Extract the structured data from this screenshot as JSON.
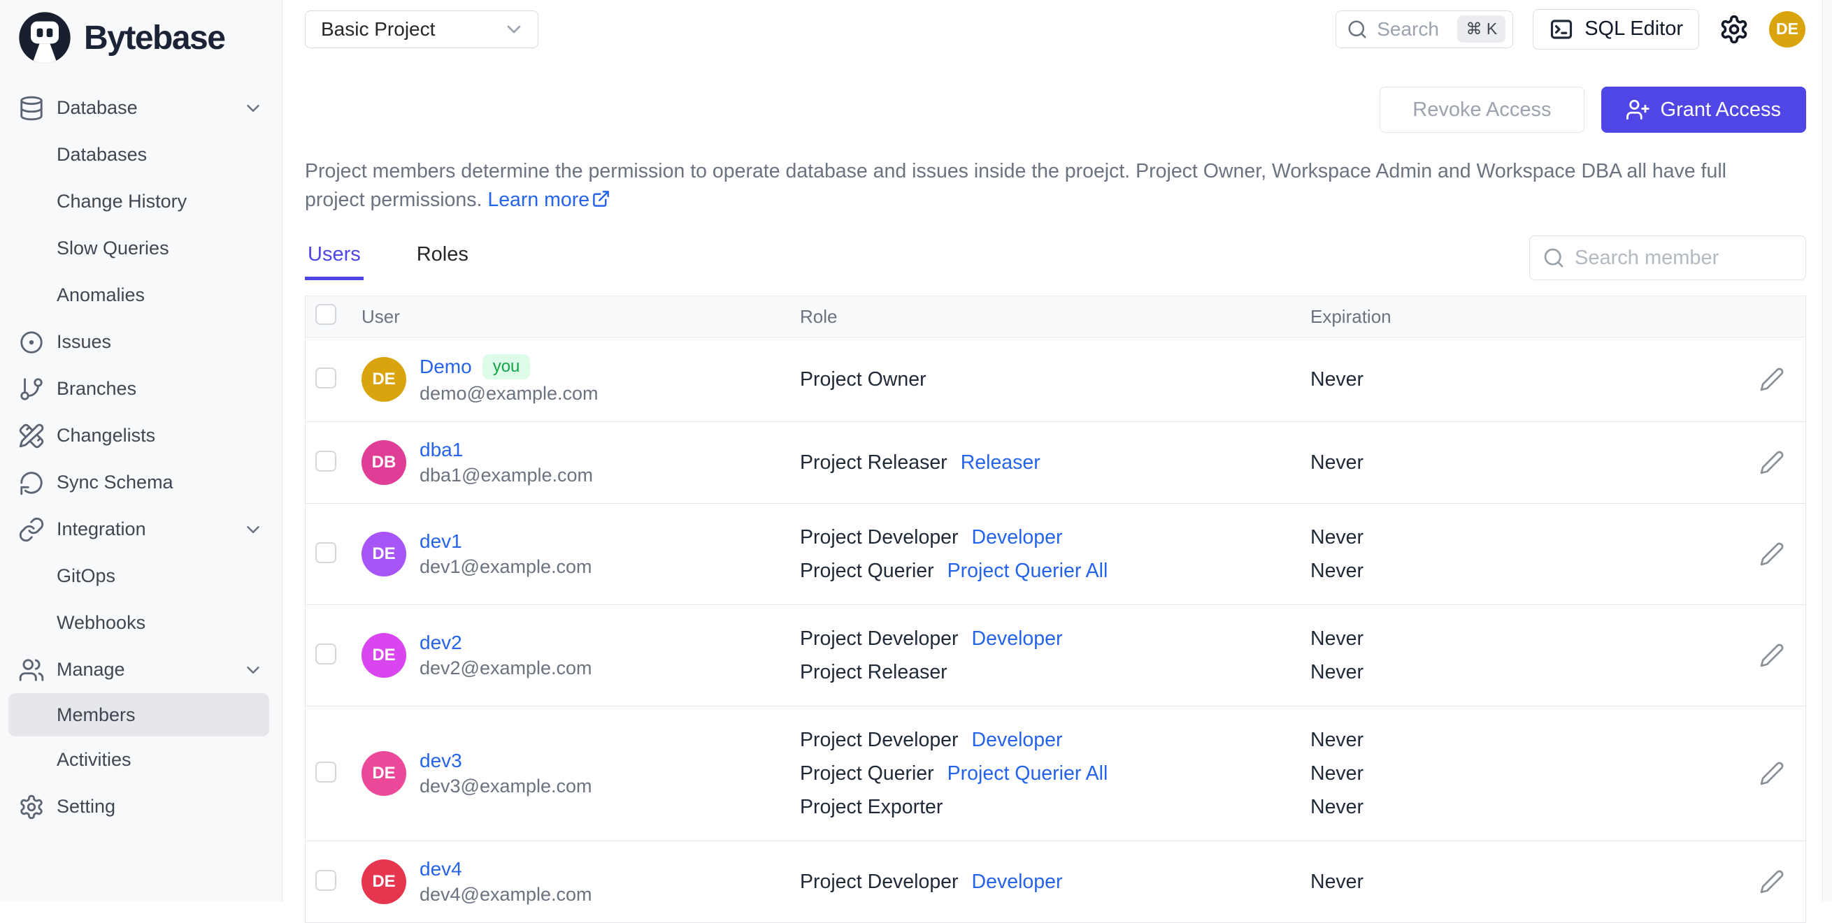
{
  "brand": {
    "name": "Bytebase"
  },
  "sidebar": {
    "items": [
      {
        "label": "Database",
        "icon": "database-icon",
        "type": "group",
        "chevron": true
      },
      {
        "label": "Databases",
        "type": "sub"
      },
      {
        "label": "Change History",
        "type": "sub"
      },
      {
        "label": "Slow Queries",
        "type": "sub"
      },
      {
        "label": "Anomalies",
        "type": "sub"
      },
      {
        "label": "Issues",
        "icon": "circle-dot-icon",
        "type": "top"
      },
      {
        "label": "Branches",
        "icon": "git-branch-icon",
        "type": "top"
      },
      {
        "label": "Changelists",
        "icon": "pencil-ruler-icon",
        "type": "top"
      },
      {
        "label": "Sync Schema",
        "icon": "sync-icon",
        "type": "top"
      },
      {
        "label": "Integration",
        "icon": "link-icon",
        "type": "group",
        "chevron": true
      },
      {
        "label": "GitOps",
        "type": "sub"
      },
      {
        "label": "Webhooks",
        "type": "sub"
      },
      {
        "label": "Manage",
        "icon": "users-icon",
        "type": "group",
        "chevron": true
      },
      {
        "label": "Members",
        "type": "sub",
        "active": true
      },
      {
        "label": "Activities",
        "type": "sub"
      },
      {
        "label": "Setting",
        "icon": "gear-icon",
        "type": "top"
      }
    ]
  },
  "topbar": {
    "project_select": "Basic Project",
    "search_placeholder": "Search",
    "search_shortcut": "⌘ K",
    "sql_editor_label": "SQL Editor",
    "avatar_initials": "DE",
    "avatar_color": "#d9a40e"
  },
  "actions": {
    "revoke_label": "Revoke Access",
    "grant_label": "Grant Access"
  },
  "description": {
    "text": "Project members determine the permission to operate database and issues inside the proejct. Project Owner, Workspace Admin and Workspace DBA all have full project permissions.",
    "learn_more": "Learn more"
  },
  "tabs": {
    "users": "Users",
    "roles": "Roles"
  },
  "member_search": {
    "placeholder": "Search member"
  },
  "colors": {
    "accent": "#4f46e5",
    "link": "#2563eb"
  },
  "table": {
    "columns": {
      "user": "User",
      "role": "Role",
      "expiration": "Expiration"
    },
    "rows": [
      {
        "name": "Demo",
        "badge": "you",
        "email": "demo@example.com",
        "initials": "DE",
        "avatar_color": "#d9a40e",
        "roles": [
          {
            "label": "Project Owner",
            "link": ""
          }
        ],
        "expirations": [
          "Never"
        ]
      },
      {
        "name": "dba1",
        "email": "dba1@example.com",
        "initials": "DB",
        "avatar_color": "#df3d96",
        "roles": [
          {
            "label": "Project Releaser",
            "link": "Releaser"
          }
        ],
        "expirations": [
          "Never"
        ]
      },
      {
        "name": "dev1",
        "email": "dev1@example.com",
        "initials": "DE",
        "avatar_color": "#a855f7",
        "roles": [
          {
            "label": "Project Developer",
            "link": "Developer"
          },
          {
            "label": "Project Querier",
            "link": "Project Querier All"
          }
        ],
        "expirations": [
          "Never",
          "Never"
        ]
      },
      {
        "name": "dev2",
        "email": "dev2@example.com",
        "initials": "DE",
        "avatar_color": "#d946ef",
        "roles": [
          {
            "label": "Project Developer",
            "link": "Developer"
          },
          {
            "label": "Project Releaser",
            "link": ""
          }
        ],
        "expirations": [
          "Never",
          "Never"
        ]
      },
      {
        "name": "dev3",
        "email": "dev3@example.com",
        "initials": "DE",
        "avatar_color": "#ec4899",
        "roles": [
          {
            "label": "Project Developer",
            "link": "Developer"
          },
          {
            "label": "Project Querier",
            "link": "Project Querier All"
          },
          {
            "label": "Project Exporter",
            "link": ""
          }
        ],
        "expirations": [
          "Never",
          "Never",
          "Never"
        ]
      },
      {
        "name": "dev4",
        "email": "dev4@example.com",
        "initials": "DE",
        "avatar_color": "#e5354f",
        "roles": [
          {
            "label": "Project Developer",
            "link": "Developer"
          }
        ],
        "expirations": [
          "Never"
        ]
      }
    ]
  }
}
